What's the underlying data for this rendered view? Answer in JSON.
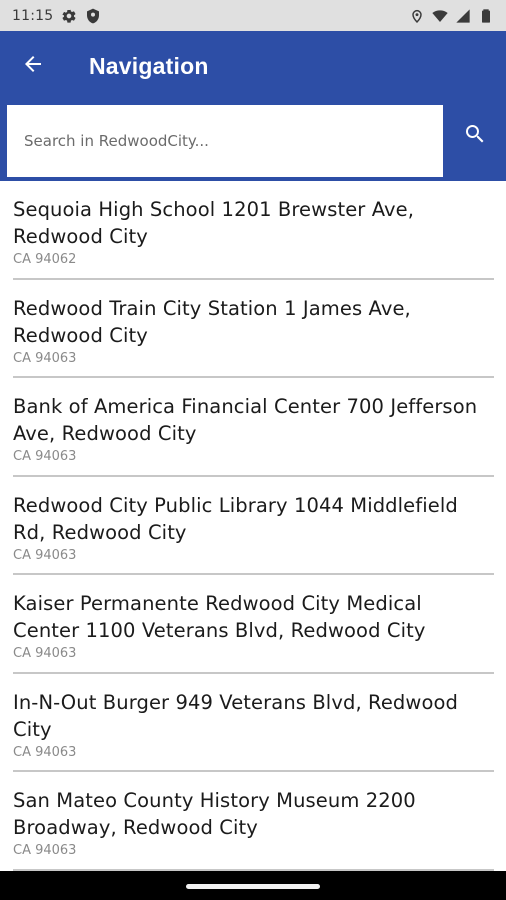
{
  "status_bar": {
    "time": "11:15",
    "left_icons": [
      "gear-icon",
      "shield-icon"
    ],
    "right_icons": [
      "location-icon",
      "wifi-icon",
      "signal-icon",
      "battery-icon"
    ]
  },
  "app_bar": {
    "title": "Navigation",
    "back_icon": "arrow-left-icon",
    "background_color": "#2d4ea6"
  },
  "search": {
    "placeholder": "Search in RedwoodCity...",
    "value": "",
    "button_icon": "search-icon"
  },
  "results": [
    {
      "title": "Sequoia High School 1201 Brewster Ave, Redwood City",
      "subtitle": "CA 94062"
    },
    {
      "title": "Redwood Train City Station 1 James Ave, Redwood City",
      "subtitle": "CA 94063"
    },
    {
      "title": "Bank of America Financial Center 700 Jefferson Ave, Redwood City",
      "subtitle": "CA 94063"
    },
    {
      "title": "Redwood City Public Library 1044 Middlefield Rd, Redwood City",
      "subtitle": "CA 94063"
    },
    {
      "title": "Kaiser Permanente Redwood City Medical Center 1100 Veterans Blvd, Redwood City",
      "subtitle": "CA 94063"
    },
    {
      "title": "In-N-Out Burger 949 Veterans Blvd, Redwood City",
      "subtitle": "CA 94063"
    },
    {
      "title": "San Mateo County History Museum 2200 Broadway, Redwood City",
      "subtitle": "CA 94063"
    }
  ]
}
